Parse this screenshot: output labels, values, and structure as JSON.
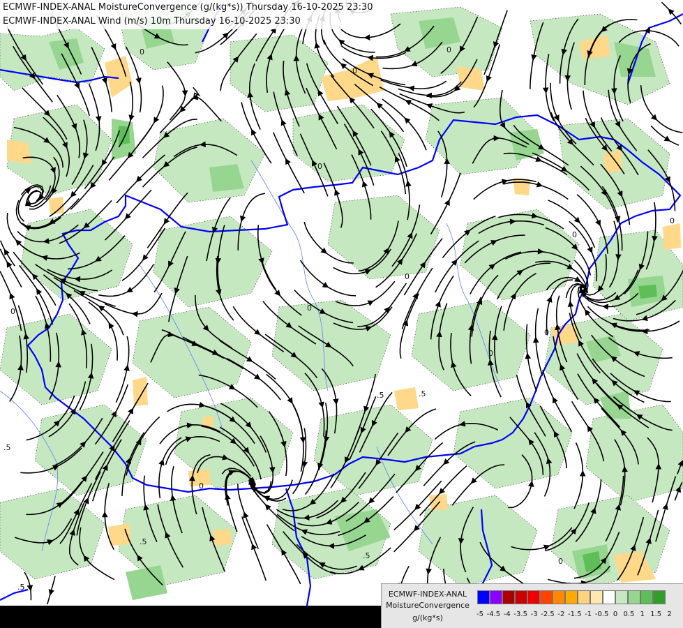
{
  "header": {
    "line1": "ECMWF-INDEX-ANAL MoistureConvergence (g/(kg*s)) Thursday 16-10-2025 23:30",
    "line2": "ECMWF-INDEX-ANAL Wind (m/s) 10m Thursday 16-10-2025 23:30"
  },
  "legend": {
    "line1": "ECMWF-INDEX-ANAL",
    "line2": "MoistureConvergence",
    "unit": "g/(kg*s)",
    "ticks": [
      "-5",
      "-4.5",
      "-4",
      "-3.5",
      "-3",
      "-2.5",
      "-2",
      "-1.5",
      "-1",
      "-0.5",
      "0",
      "0.5",
      "1",
      "1.5",
      "2"
    ],
    "colors": [
      "#0000ff",
      "#8b00ff",
      "#aa0000",
      "#cc0000",
      "#ee0000",
      "#ff4400",
      "#ff8800",
      "#ffaa00",
      "#ffd280",
      "#ffe8b0",
      "#ffffff",
      "#c6e8c0",
      "#96d690",
      "#5ebe58",
      "#2ea02a"
    ]
  },
  "map": {
    "contour_labels": [
      "0",
      "0",
      "0",
      ".5",
      ".5",
      ".5",
      "0",
      "0",
      "0",
      "0",
      "0",
      "0",
      "0",
      ".5",
      ".5",
      "0",
      "0",
      "0",
      ".5"
    ],
    "colors": {
      "background": "#ffffff",
      "convergence_light": "#c6e8c0",
      "convergence_mid": "#96d690",
      "convergence_strong": "#5ebe58",
      "divergence_light": "#ffd88a",
      "border": "#0000ff",
      "river": "#5a7fff",
      "streamline": "#000000"
    }
  }
}
